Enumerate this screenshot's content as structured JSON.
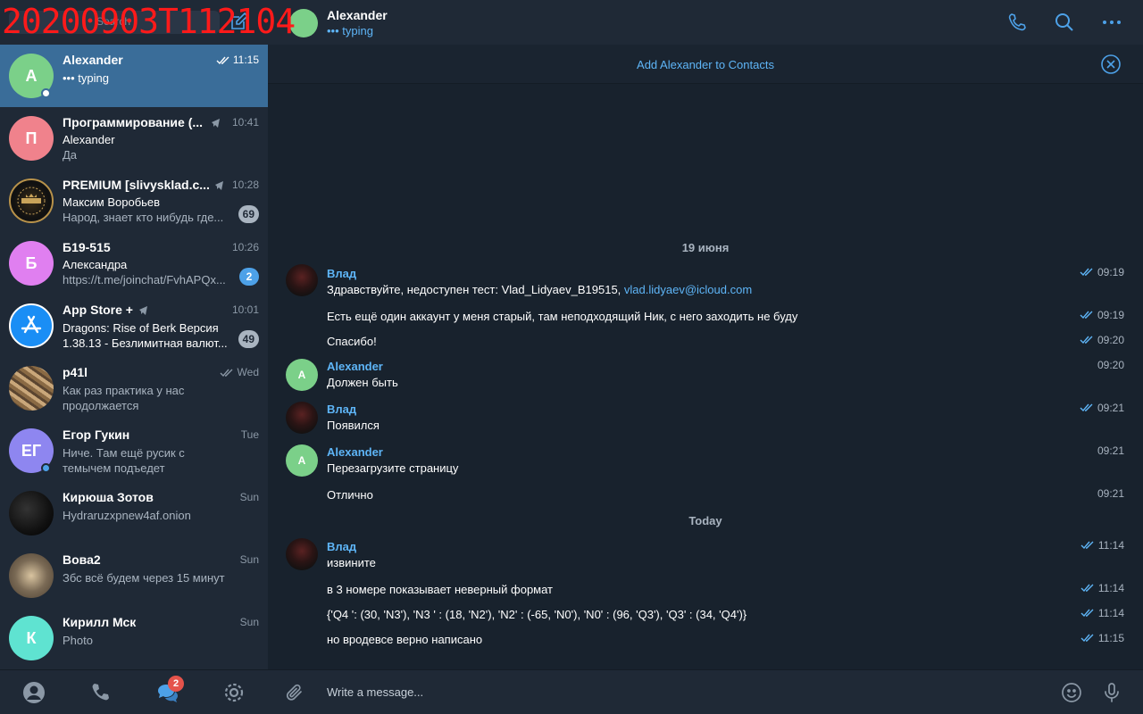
{
  "watermark": "20200903T112104",
  "search": {
    "placeholder": "Search"
  },
  "chats": [
    {
      "name": "Alexander",
      "time": "11:15",
      "preview": "••• typing",
      "avatar_letter": "A",
      "avatar_color": "#7bd089",
      "active": true
    },
    {
      "name": "Программирование (...",
      "time": "10:41",
      "sender": "Alexander",
      "preview": "Да",
      "avatar_letter": "П",
      "avatar_color": "#f0828c"
    },
    {
      "name": "PREMIUM [slivysklad.c...",
      "time": "10:28",
      "sender": "Максим Воробьев",
      "preview": "Народ, знает кто нибудь где...",
      "badge": "69"
    },
    {
      "name": "Б19-515",
      "time": "10:26",
      "sender": "Александра",
      "preview": "https://t.me/joinchat/FvhAPQx...",
      "badge": "2",
      "avatar_letter": "Б",
      "avatar_color": "#e07ff0"
    },
    {
      "name": "App Store +",
      "time": "10:01",
      "preview": "Dragons: Rise of Berk Версия 1.38.13  - Безлимитная валют...",
      "badge": "49"
    },
    {
      "name": "p41l",
      "time": "Wed",
      "preview": "Как раз практика у нас продолжается"
    },
    {
      "name": "Егор Гукин",
      "time": "Tue",
      "preview": "Ниче. Там ещё русик с темычем подъедет",
      "avatar_letter": "ЕГ",
      "avatar_color": "#8e86f0"
    },
    {
      "name": "Кирюша Зотов",
      "time": "Sun",
      "preview": "Hydraruzxpnew4af.onion"
    },
    {
      "name": "Вова2",
      "time": "Sun",
      "preview": "Збс всё будем через 15 минут"
    },
    {
      "name": "Кирилл Мск",
      "time": "Sun",
      "preview": "Photo",
      "avatar_letter": "К",
      "avatar_color": "#5fe3d1"
    }
  ],
  "tabs": {
    "chats_badge": "2"
  },
  "header": {
    "name": "Alexander",
    "status": "••• typing"
  },
  "contact_bar": {
    "label": "Add Alexander to Contacts"
  },
  "dates": {
    "first": "19 июня",
    "second": "Today"
  },
  "messages": [
    {
      "sender": "Влад",
      "text": "Здравствуйте, недоступен тест: Vlad_Lidyaev_B19515, ",
      "link": "vlad.lidyaev@icloud.com",
      "time": "09:19"
    },
    {
      "text": "Есть ещё один аккаунт у меня старый, там неподходящий Ник, с него заходить не буду",
      "time": "09:19"
    },
    {
      "text": "Спасибо!",
      "time": "09:20"
    },
    {
      "sender": "Alexander",
      "text": "Должен быть",
      "time": "09:20",
      "avatar_letter": "A"
    },
    {
      "sender": "Влад",
      "text": "Появился",
      "time": "09:21"
    },
    {
      "sender": "Alexander",
      "text": "Перезагрузите страницу",
      "time": "09:21",
      "avatar_letter": "A"
    },
    {
      "text": "Отлично",
      "time": "09:21"
    },
    {
      "sender": "Влад",
      "text": "извините",
      "time": "11:14"
    },
    {
      "text": "в 3 номере показывает неверный формат",
      "time": "11:14"
    },
    {
      "text": "{'Q4 ': (30, 'N3'), 'N3 ' : (18, 'N2'), 'N2' : (-65, 'N0'), 'N0' : (96, 'Q3'), 'Q3' : (34, 'Q4')}",
      "time": "11:14"
    },
    {
      "text": "но вродевсе верно написано",
      "time": "11:15"
    }
  ],
  "composer": {
    "placeholder": "Write a message..."
  },
  "colors": {
    "accent": "#5eb5f7",
    "active_chat": "#3a6d99",
    "sidebar": "#1f2936",
    "background": "#18222d"
  }
}
